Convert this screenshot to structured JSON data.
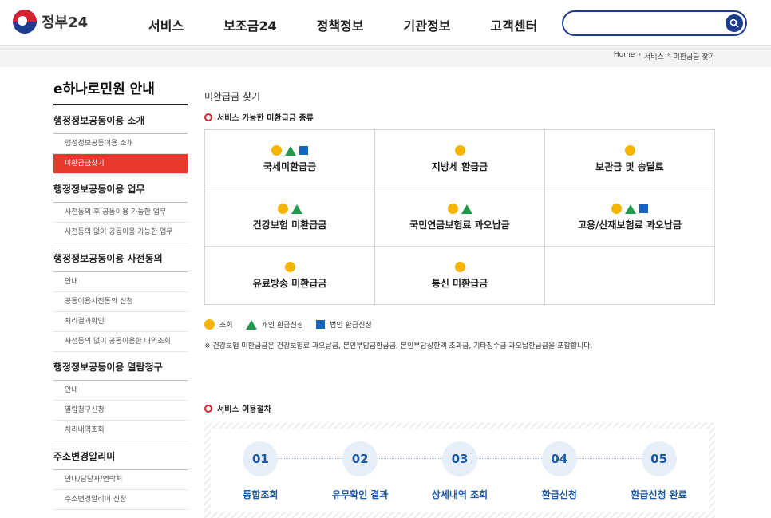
{
  "header": {
    "logo_text": "정부24",
    "nav": [
      "서비스",
      "보조금24",
      "정책정보",
      "기관정보",
      "고객센터"
    ],
    "search_placeholder": ""
  },
  "breadcrumb": [
    "Home",
    "서비스",
    "미환급금 찾기"
  ],
  "sidebar": {
    "title": "e하나로민원 안내",
    "groups": [
      {
        "label": "행정정보공동이용 소개",
        "items": [
          "행정정보공동이용 소개",
          "미환급금찾기"
        ]
      },
      {
        "label": "행정정보공동이용 업무",
        "items": [
          "사전동의 후 공동이용 가능한 업무",
          "사전동의 없이 공동이용 가능한 업무"
        ]
      },
      {
        "label": "행정정보공동이용 사전동의",
        "items": [
          "안내",
          "공동이용사전동의 신청",
          "처리결과확인",
          "사전동의 없이 공동이용한 내역조회"
        ]
      },
      {
        "label": "행정정보공동이용 열람청구",
        "items": [
          "안내",
          "열람청구신청",
          "처리내역조회"
        ]
      },
      {
        "label": "주소변경알리미",
        "items": [
          "안내/담당자/연락처",
          "주소변경알리미 신청"
        ]
      }
    ],
    "active_item": "미환급금찾기"
  },
  "main": {
    "page_title": "미환급금 찾기",
    "section1_title": "서비스 가능한 미환급금 종류",
    "refund_types": [
      {
        "label": "국세미환급금",
        "marks": [
          "circle",
          "triangle",
          "square"
        ]
      },
      {
        "label": "지방세 환급금",
        "marks": [
          "circle"
        ]
      },
      {
        "label": "보관금 및 송달료",
        "marks": [
          "circle"
        ]
      },
      {
        "label": "건강보험 미환급금",
        "marks": [
          "circle",
          "triangle"
        ]
      },
      {
        "label": "국민연금보험료 과오납금",
        "marks": [
          "circle",
          "triangle"
        ]
      },
      {
        "label": "고용/산재보험료 과오납금",
        "marks": [
          "circle",
          "triangle",
          "square"
        ]
      },
      {
        "label": "유료방송 미환급금",
        "marks": [
          "circle"
        ]
      },
      {
        "label": "통신 미환급금",
        "marks": [
          "circle"
        ]
      },
      {
        "label": "",
        "marks": []
      }
    ],
    "legend": {
      "circle": "조회",
      "triangle": "개인 환급신청",
      "square": "법인 환급신청"
    },
    "note": "※ 건강보험 미환급금은 건강보험료 과오납금, 본인부담금환급금, 본인부담상한액 초과금, 기타징수금 과오납환급금을 포함합니다.",
    "section2_title": "서비스 이용절차",
    "steps": [
      {
        "num": "01",
        "label": "통합조회"
      },
      {
        "num": "02",
        "label": "유무확인 결과"
      },
      {
        "num": "03",
        "label": "상세내역 조회"
      },
      {
        "num": "04",
        "label": "환급신청"
      },
      {
        "num": "05",
        "label": "환급신청 완료"
      }
    ]
  },
  "colors": {
    "brand_blue": "#1c3c8c",
    "active_red": "#e8392c",
    "circle_yellow": "#f5b400",
    "triangle_green": "#1f9a4a",
    "square_blue": "#1565c0"
  }
}
